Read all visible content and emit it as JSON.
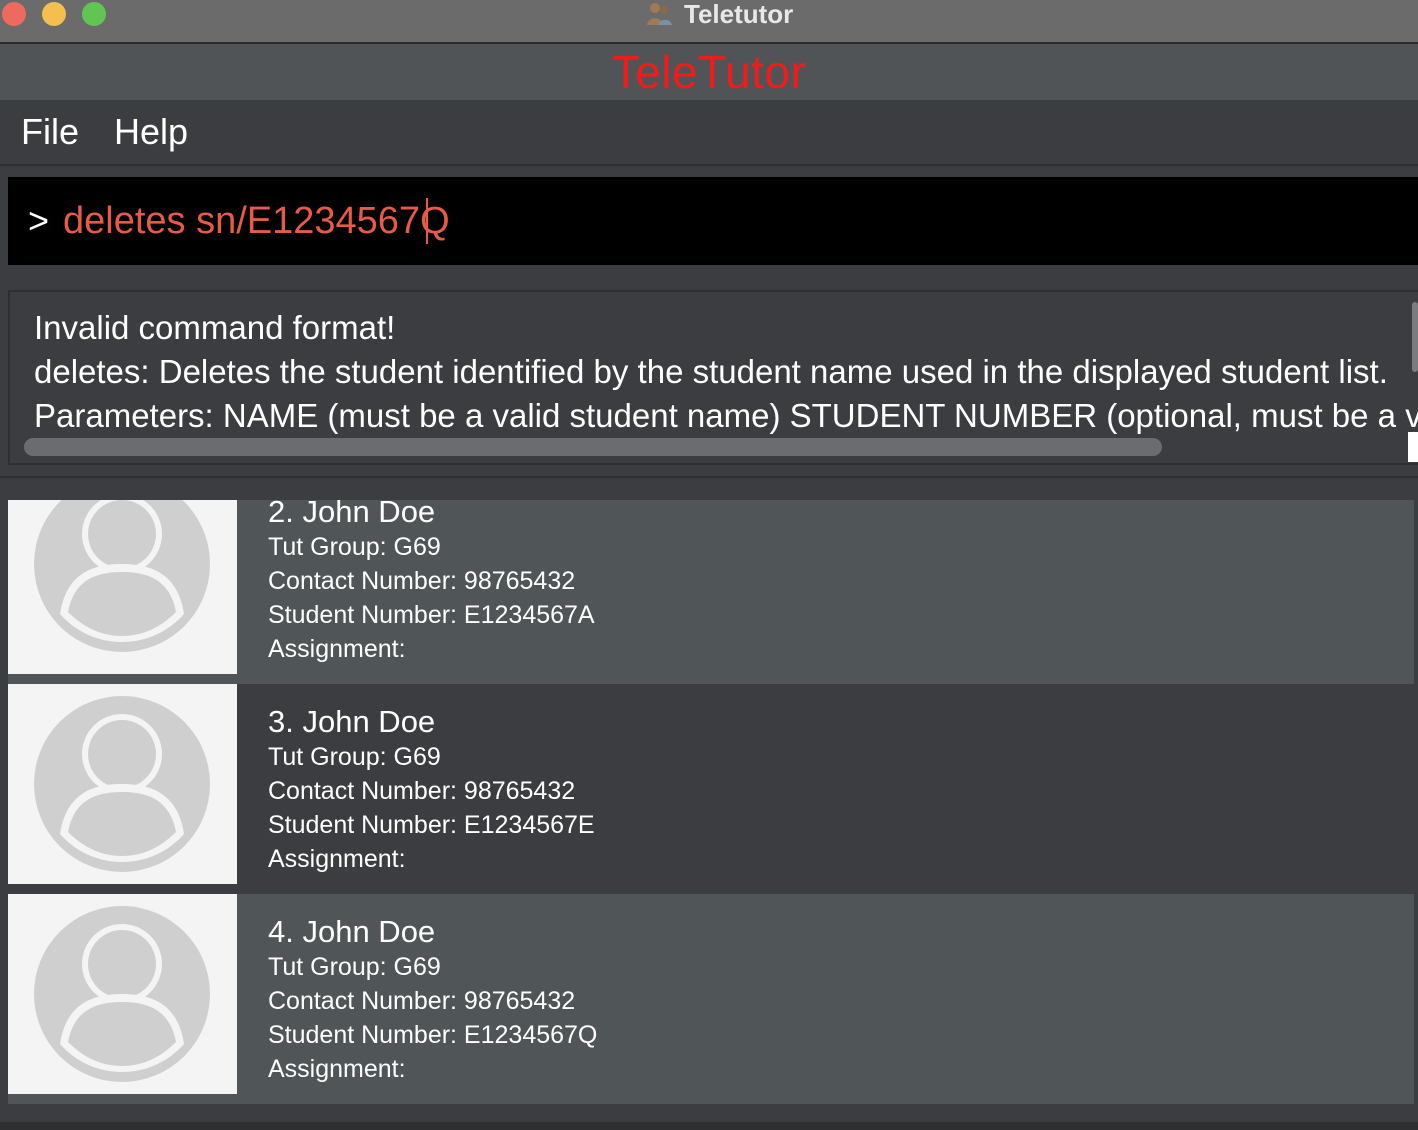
{
  "window": {
    "title": "Teletutor"
  },
  "app": {
    "brand": "TeleTutor"
  },
  "menu": {
    "file": "File",
    "help": "Help"
  },
  "command": {
    "prompt": ">",
    "value": "deletes sn/E1234567Q"
  },
  "result": {
    "line1": "Invalid command format!",
    "line2": "deletes: Deletes the student identified by the student name used in the displayed student list.",
    "line3": "Parameters: NAME (must be a valid student name) STUDENT NUMBER (optional, must be a vali"
  },
  "students": [
    {
      "name": "2. John Doe",
      "tut_group": "Tut Group: G69",
      "contact": "Contact Number: 98765432",
      "student_number": "Student Number: E1234567A",
      "assignment": "Assignment:"
    },
    {
      "name": "3. John Doe",
      "tut_group": "Tut Group: G69",
      "contact": "Contact Number: 98765432",
      "student_number": "Student Number: E1234567E",
      "assignment": "Assignment:"
    },
    {
      "name": "4. John Doe",
      "tut_group": "Tut Group: G69",
      "contact": "Contact Number: 98765432",
      "student_number": "Student Number: E1234567Q",
      "assignment": "Assignment:"
    }
  ],
  "colors": {
    "brand": "#f21b1b",
    "command_text": "#e85a48",
    "card_light": "#505558",
    "card_dark": "#3b3d40"
  },
  "icons": {
    "avatar": "user-avatar-icon",
    "app": "teletutor-app-icon"
  }
}
